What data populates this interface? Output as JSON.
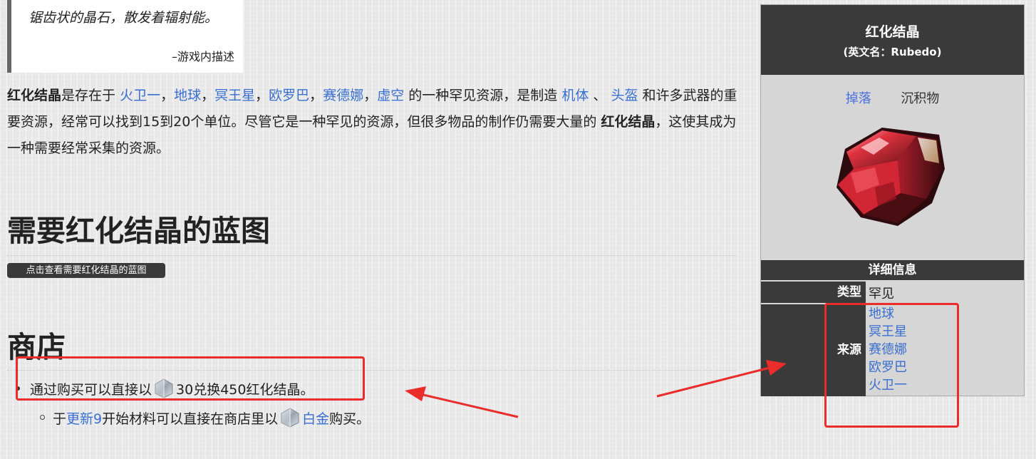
{
  "quote": {
    "text": "锯齿状的晶石，散发着辐射能。",
    "source": "–游戏内描述"
  },
  "intro": {
    "item_name": "红化结晶",
    "text_1": "是存在于 ",
    "planets": [
      "火卫一",
      "地球",
      "冥王星",
      "欧罗巴",
      "赛德娜",
      "虚空"
    ],
    "sep": "，",
    "text_2": " 的一种罕见资源，是制造 ",
    "link_frame": "机体",
    "text_3": " 、 ",
    "link_helmet": "头盔",
    "text_4": " 和许多武器的重要资源，经常可以找到15到20个单位。尽管它是一种罕见的资源，但很多物品的制作仍需要大量的 ",
    "item_name_2": "红化结晶",
    "text_5": "，这使其成为一种需要经常采集的资源。"
  },
  "blueprints": {
    "heading": "需要红化结晶的蓝图",
    "button": "点击查看需要红化结晶的蓝图"
  },
  "shop": {
    "heading": "商店",
    "item1_pre": "通过购买可以直接以",
    "item1_post": "30兑换450红化结晶。",
    "sub_pre": "于",
    "sub_link": "更新9",
    "sub_mid": "开始材料可以直接在商店里以",
    "sub_link2": "白金",
    "sub_post": "购买。"
  },
  "infobox": {
    "title": "红化结晶",
    "subtitle": "(英文名：Rubedo)",
    "tab_drop": "掉落",
    "tab_deposit": "沉积物",
    "detail_header": "详细信息",
    "type_label": "类型",
    "type_value": "罕见",
    "source_label": "来源",
    "sources": [
      "地球",
      "冥王星",
      "赛德娜",
      "欧罗巴",
      "火卫一"
    ]
  },
  "colors": {
    "link": "#3a6fd0",
    "infobox_dark": "#3a3a3a",
    "annotation_red": "#ea2c2a"
  }
}
